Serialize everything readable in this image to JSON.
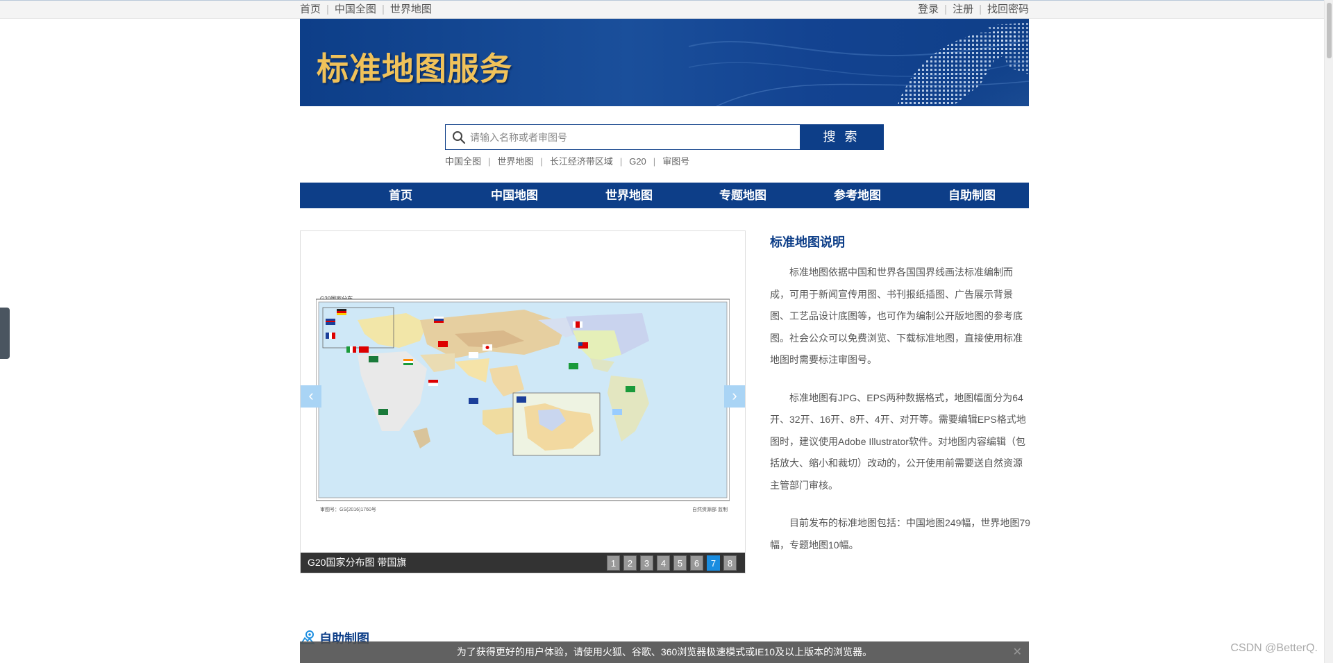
{
  "topbar": {
    "links_left": [
      "首页",
      "中国全图",
      "世界地图"
    ],
    "links_right": [
      "登录",
      "注册",
      "找回密码"
    ]
  },
  "banner": {
    "title": "标准地图服务"
  },
  "search": {
    "placeholder": "请输入名称或者审图号",
    "button": "搜 索",
    "quick_links": [
      "中国全图",
      "世界地图",
      "长江经济带区域",
      "G20",
      "审图号"
    ]
  },
  "nav": {
    "items": [
      "首页",
      "中国地图",
      "世界地图",
      "专题地图",
      "参考地图",
      "自助制图"
    ]
  },
  "carousel": {
    "map_heading": "G20国家分布",
    "map_footer_left": "审图号：GS(2016)1760号",
    "map_footer_right": "自然资源部 监制",
    "caption": "G20国家分布图 带国旗",
    "pages": [
      "1",
      "2",
      "3",
      "4",
      "5",
      "6",
      "7",
      "8"
    ],
    "active_page": "7",
    "prev": "‹",
    "next": "›"
  },
  "info": {
    "title": "标准地图说明",
    "paragraphs": [
      "标准地图依据中国和世界各国国界线画法标准编制而成，可用于新闻宣传用图、书刊报纸插图、广告展示背景图、工艺品设计底图等，也可作为编制公开版地图的参考底图。社会公众可以免费浏览、下载标准地图，直接使用标准地图时需要标注审图号。",
      "标准地图有JPG、EPS两种数据格式，地图幅面分为64开、32开、16开、8开、4开、对开等。需要编辑EPS格式地图时，建议使用Adobe Illustrator软件。对地图内容编辑（包括放大、缩小和裁切）改动的，公开使用前需要送自然资源主管部门审核。",
      "目前发布的标准地图包括：中国地图249幅，世界地图79幅，专题地图10幅。"
    ]
  },
  "section": {
    "title": "自助制图"
  },
  "notice": {
    "text": "为了获得更好的用户体验，请使用火狐、谷歌、360浏览器极速模式或IE10及以上版本的浏览器。",
    "close": "✕"
  },
  "watermark": "CSDN @BetterQ.",
  "colors": {
    "brand_blue": "#0d3e88",
    "gold": "#f0c25a",
    "active_page": "#1a8de0"
  }
}
